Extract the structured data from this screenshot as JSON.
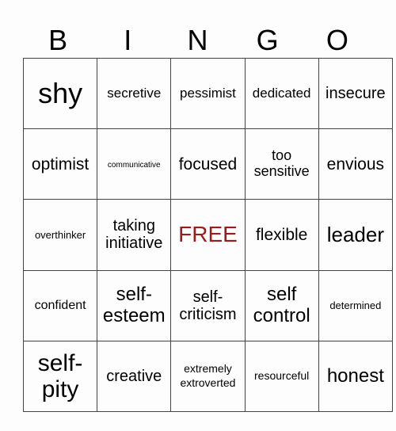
{
  "header": [
    "B",
    "I",
    "N",
    "G",
    "O"
  ],
  "free_color": "#9e1b1b",
  "cells": [
    [
      {
        "text": "shy",
        "size": 36
      },
      {
        "text": "secretive",
        "size": 17
      },
      {
        "text": "pessimist",
        "size": 17
      },
      {
        "text": "dedicated",
        "size": 17
      },
      {
        "text": "insecure",
        "size": 20
      }
    ],
    [
      {
        "text": "optimist",
        "size": 21
      },
      {
        "text": "communicative",
        "size": 10
      },
      {
        "text": "focused",
        "size": 21
      },
      {
        "text": "too sensitive",
        "size": 18
      },
      {
        "text": "envious",
        "size": 21
      }
    ],
    [
      {
        "text": "overthinker",
        "size": 13
      },
      {
        "text": "taking initiative",
        "size": 20
      },
      {
        "text": "FREE",
        "size": 28,
        "free": true
      },
      {
        "text": "flexible",
        "size": 21
      },
      {
        "text": "leader",
        "size": 26
      }
    ],
    [
      {
        "text": "confident",
        "size": 16
      },
      {
        "text": "self-esteem",
        "size": 24
      },
      {
        "text": "self-criticism",
        "size": 20
      },
      {
        "text": "self control",
        "size": 24
      },
      {
        "text": "determined",
        "size": 13
      }
    ],
    [
      {
        "text": "self-pity",
        "size": 30
      },
      {
        "text": "creative",
        "size": 20
      },
      {
        "text": "extremely extroverted",
        "size": 14
      },
      {
        "text": "resourceful",
        "size": 14
      },
      {
        "text": "honest",
        "size": 24
      }
    ]
  ]
}
